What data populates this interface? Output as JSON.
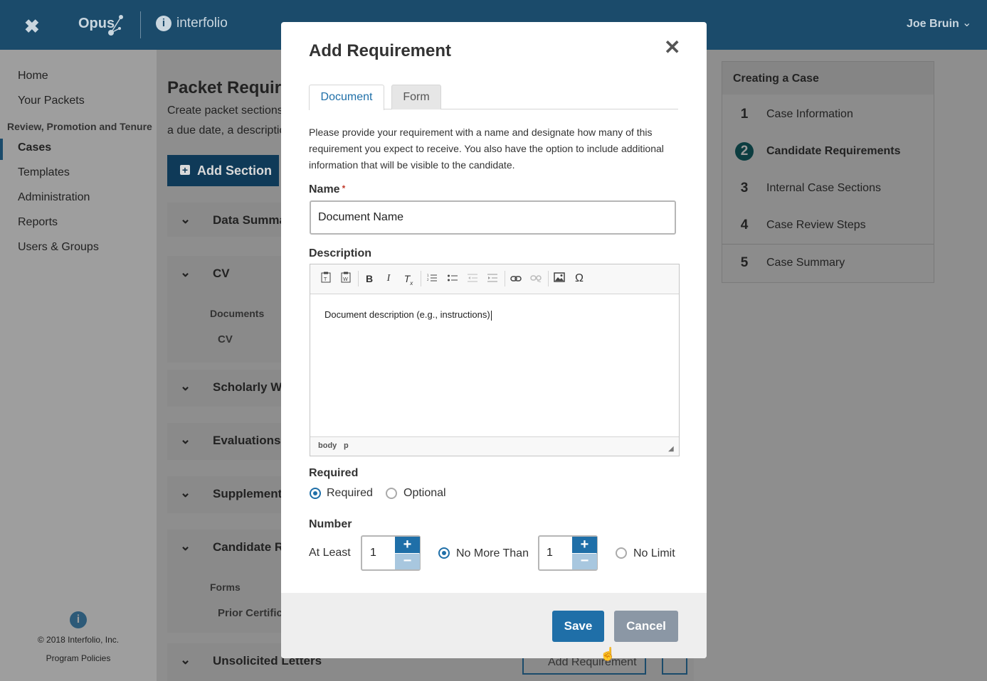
{
  "topbar": {
    "close": "✖",
    "app_name": "Opus",
    "partner": "interfolio",
    "user": "Joe Bruin"
  },
  "sidebar": {
    "items": [
      "Home",
      "Your Packets"
    ],
    "section": "Review, Promotion and Tenure",
    "section_items": [
      "Cases",
      "Templates",
      "Administration",
      "Reports",
      "Users & Groups"
    ],
    "copyright": "© 2018 Interfolio, Inc.",
    "policies": "Program Policies"
  },
  "page": {
    "title": "Packet Requir",
    "subtitle_line1": "Create packet sections",
    "subtitle_line2": "a due date, a descriptio",
    "add_section": "Add Section",
    "rows": [
      "Data Summa",
      "CV",
      "Scholarly Wo",
      "Evaluations o",
      "Supplement",
      "Candidate Re",
      "Unsolicited Letters"
    ],
    "documents_label": "Documents",
    "documents_item": "CV",
    "forms_label": "Forms",
    "forms_item": "Prior Certific",
    "add_requirement": "Add Requirement"
  },
  "steps": {
    "title": "Creating a Case",
    "items": [
      {
        "num": "1",
        "label": "Case Information"
      },
      {
        "num": "2",
        "label": "Candidate Requirements"
      },
      {
        "num": "3",
        "label": "Internal Case Sections"
      },
      {
        "num": "4",
        "label": "Case Review Steps"
      },
      {
        "num": "5",
        "label": "Case Summary"
      }
    ]
  },
  "modal": {
    "title": "Add Requirement",
    "tabs": [
      "Document",
      "Form"
    ],
    "description": "Please provide your requirement with a name and designate how many of this requirement you expect to receive. You also have the option to include additional information that will be visible to the candidate.",
    "name_label": "Name",
    "required_marker": "*",
    "name_value": "Document Name",
    "description_label": "Description",
    "editor_text": "Document description (e.g., instructions)",
    "editor_path": [
      "body",
      "p"
    ],
    "required_label": "Required",
    "required_options": [
      "Required",
      "Optional"
    ],
    "required_selected": "Required",
    "number_label": "Number",
    "at_least_label": "At Least",
    "at_least_value": "1",
    "no_more_than_label": "No More Than",
    "no_more_than_value": "1",
    "no_limit_label": "No Limit",
    "number_selected": "No More Than",
    "save": "Save",
    "cancel": "Cancel"
  },
  "colors": {
    "brand": "#1b4b6b",
    "accent": "#1f6fa8",
    "cancel": "#8b97a5"
  }
}
